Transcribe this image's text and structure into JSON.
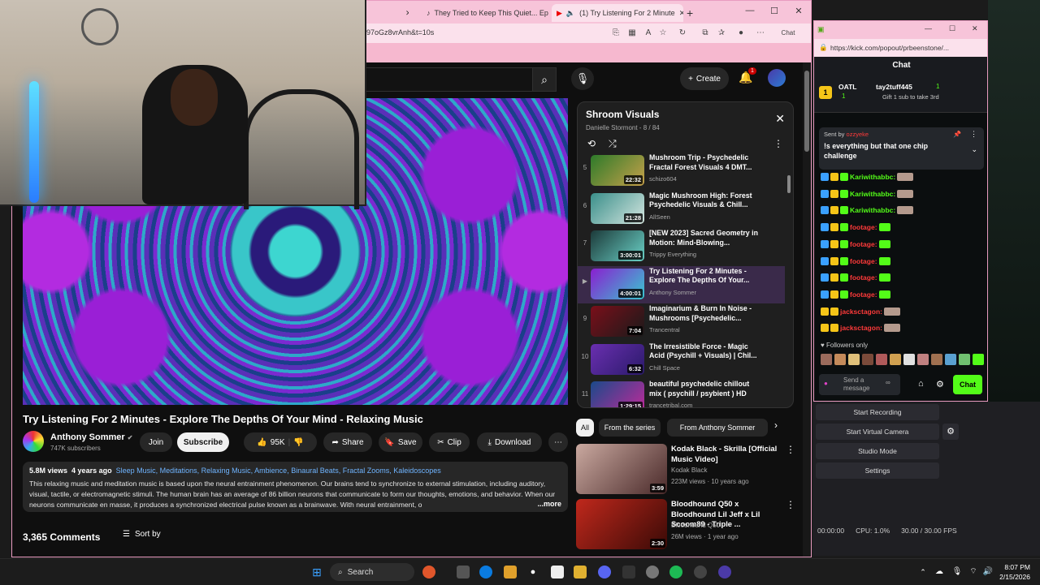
{
  "browser": {
    "tabs": [
      {
        "label": "They Tried to Keep This Quiet... Ep"
      },
      {
        "label": "(1) Try Listening For 2 Minute"
      }
    ],
    "address": "97oGz8vrAnh&t=10s",
    "chat_label": "Chat"
  },
  "youtube": {
    "create_label": "Create",
    "notif_count": "1",
    "video_title": "Try Listening For 2 Minutes - Explore The Depths Of Your Mind - Relaxing Music",
    "channel_name": "Anthony Sommer",
    "subscribers": "747K subscribers",
    "join_label": "Join",
    "subscribe_label": "Subscribe",
    "likes": "95K",
    "share_label": "Share",
    "save_label": "Save",
    "clip_label": "Clip",
    "download_label": "Download",
    "views": "5.8M views",
    "age": "4 years ago",
    "tags": "Sleep Music, Meditations, Relaxing Music, Ambience, Binaural Beats, Fractal Zooms, Kaleidoscopes",
    "description": "This relaxing music and meditation music is based upon the neural entrainment phenomenon. Our brains tend to synchronize to external stimulation, including auditory, visual, tactile, or electromagnetic stimuli. The human brain has an average of 86 billion neurons that communicate to form our thoughts, emotions, and behavior. When our neurons communicate en masse, it produces a synchronized electrical pulse known as a brainwave. With neural entrainment, o",
    "more_label": "...more",
    "comments": "3,365 Comments",
    "sort_label": "Sort by"
  },
  "playlist": {
    "title": "Shroom Visuals",
    "subtitle": "Danielle Stormont - 8 / 84",
    "items": [
      {
        "idx": "5",
        "title": "Mushroom Trip - Psychedelic Fractal Forest Visuals 4 DMT...",
        "channel": "schizo604",
        "duration": "22:32",
        "c1": "#2d7a2a",
        "c2": "#c7a14a"
      },
      {
        "idx": "6",
        "title": "Magic Mushroom High: Forest Psychedelic Visuals & Chill...",
        "channel": "AllSeen",
        "duration": "21:28",
        "c1": "#3a8f8a",
        "c2": "#d5e6e0"
      },
      {
        "idx": "7",
        "title": "[NEW 2023] Sacred Geometry in Motion: Mind-Blowing...",
        "channel": "Trippy Everything",
        "duration": "3:00:01",
        "c1": "#1c3a3a",
        "c2": "#6ad1c6"
      },
      {
        "idx": "▶",
        "title": "Try Listening For 2 Minutes - Explore The Depths Of Your...",
        "channel": "Anthony Sommer",
        "duration": "4:00:01",
        "c1": "#8a1fd0",
        "c2": "#38c8d0"
      },
      {
        "idx": "9",
        "title": "Imaginarium & Burn In Noise - Mushrooms [Psychedelic...",
        "channel": "Trancentral",
        "duration": "7:04",
        "c1": "#7a0f1a",
        "c2": "#1a1a1a"
      },
      {
        "idx": "10",
        "title": "The Irresistible Force - Magic Acid (Psychill + Visuals) | Chil...",
        "channel": "Chill Space",
        "duration": "6:32",
        "c1": "#6a2fb0",
        "c2": "#2a1a6a"
      },
      {
        "idx": "11",
        "title": "beautiful psychedelic chillout mix ( psychill / psybient ) HD",
        "channel": "trancetribal.com",
        "duration": "1:29:15",
        "c1": "#1a4a8a",
        "c2": "#c02a9a"
      }
    ]
  },
  "chips": {
    "all": "All",
    "series": "From the series",
    "from": "From Anthony Sommer"
  },
  "recommended": [
    {
      "title": "Kodak Black - Skrilla [Official Music Video]",
      "channel": "Kodak Black",
      "meta": "223M views · 10 years ago",
      "duration": "3:59",
      "c1": "#caa9a0",
      "c2": "#4a2a2a"
    },
    {
      "title": "Bloodhound Q50 x Bloodhound Lil Jeff x Lil Scoom89 - Triple ...",
      "channel": "Bloodhound Q50",
      "meta": "26M views · 1 year ago",
      "duration": "2:30",
      "c1": "#c0281c",
      "c2": "#3a0a06"
    }
  ],
  "kick": {
    "address": "https://kick.com/popout/prbeenstone/...",
    "chat_header": "Chat",
    "gifter": "tay2tuff445",
    "gift_count": "1",
    "gift_text": "Gift 1 sub to take 3rd",
    "top_label": "OATL",
    "top_count": "1",
    "pinned_by": "Sent by",
    "pinned_user": "ozzyeke",
    "pinned_text": "!s everything but that one chip challenge",
    "messages": [
      {
        "user": "Kariwithabbc:",
        "color": "#53fc18",
        "emote": "face"
      },
      {
        "user": "Kariwithabbc:",
        "color": "#53fc18",
        "emote": "face"
      },
      {
        "user": "Kariwithabbc:",
        "color": "#53fc18",
        "emote": "face"
      },
      {
        "user": "footage:",
        "color": "#ff3a3a",
        "emote": "green"
      },
      {
        "user": "footage:",
        "color": "#ff3a3a",
        "emote": "green"
      },
      {
        "user": "footage:",
        "color": "#ff3a3a",
        "emote": "green"
      },
      {
        "user": "footage:",
        "color": "#ff3a3a",
        "emote": "green"
      },
      {
        "user": "footage:",
        "color": "#ff3a3a",
        "emote": "green"
      },
      {
        "user": "jacksctagon:",
        "color": "#ff3a3a",
        "emote": "face"
      },
      {
        "user": "jacksctagon:",
        "color": "#ff3a3a",
        "emote": "face"
      }
    ],
    "followers_only": "Followers only",
    "input_placeholder": "Send a message",
    "chat_button": "Chat"
  },
  "obs": {
    "start_recording": "Start Recording",
    "start_virtual_camera": "Start Virtual Camera",
    "studio_mode": "Studio Mode",
    "settings": "Settings",
    "time": "00:00:00",
    "cpu": "CPU: 1.0%",
    "fps": "30.00 / 30.00 FPS"
  },
  "taskbar": {
    "search": "Search",
    "time": "8:07 PM",
    "date": "2/15/2026"
  }
}
